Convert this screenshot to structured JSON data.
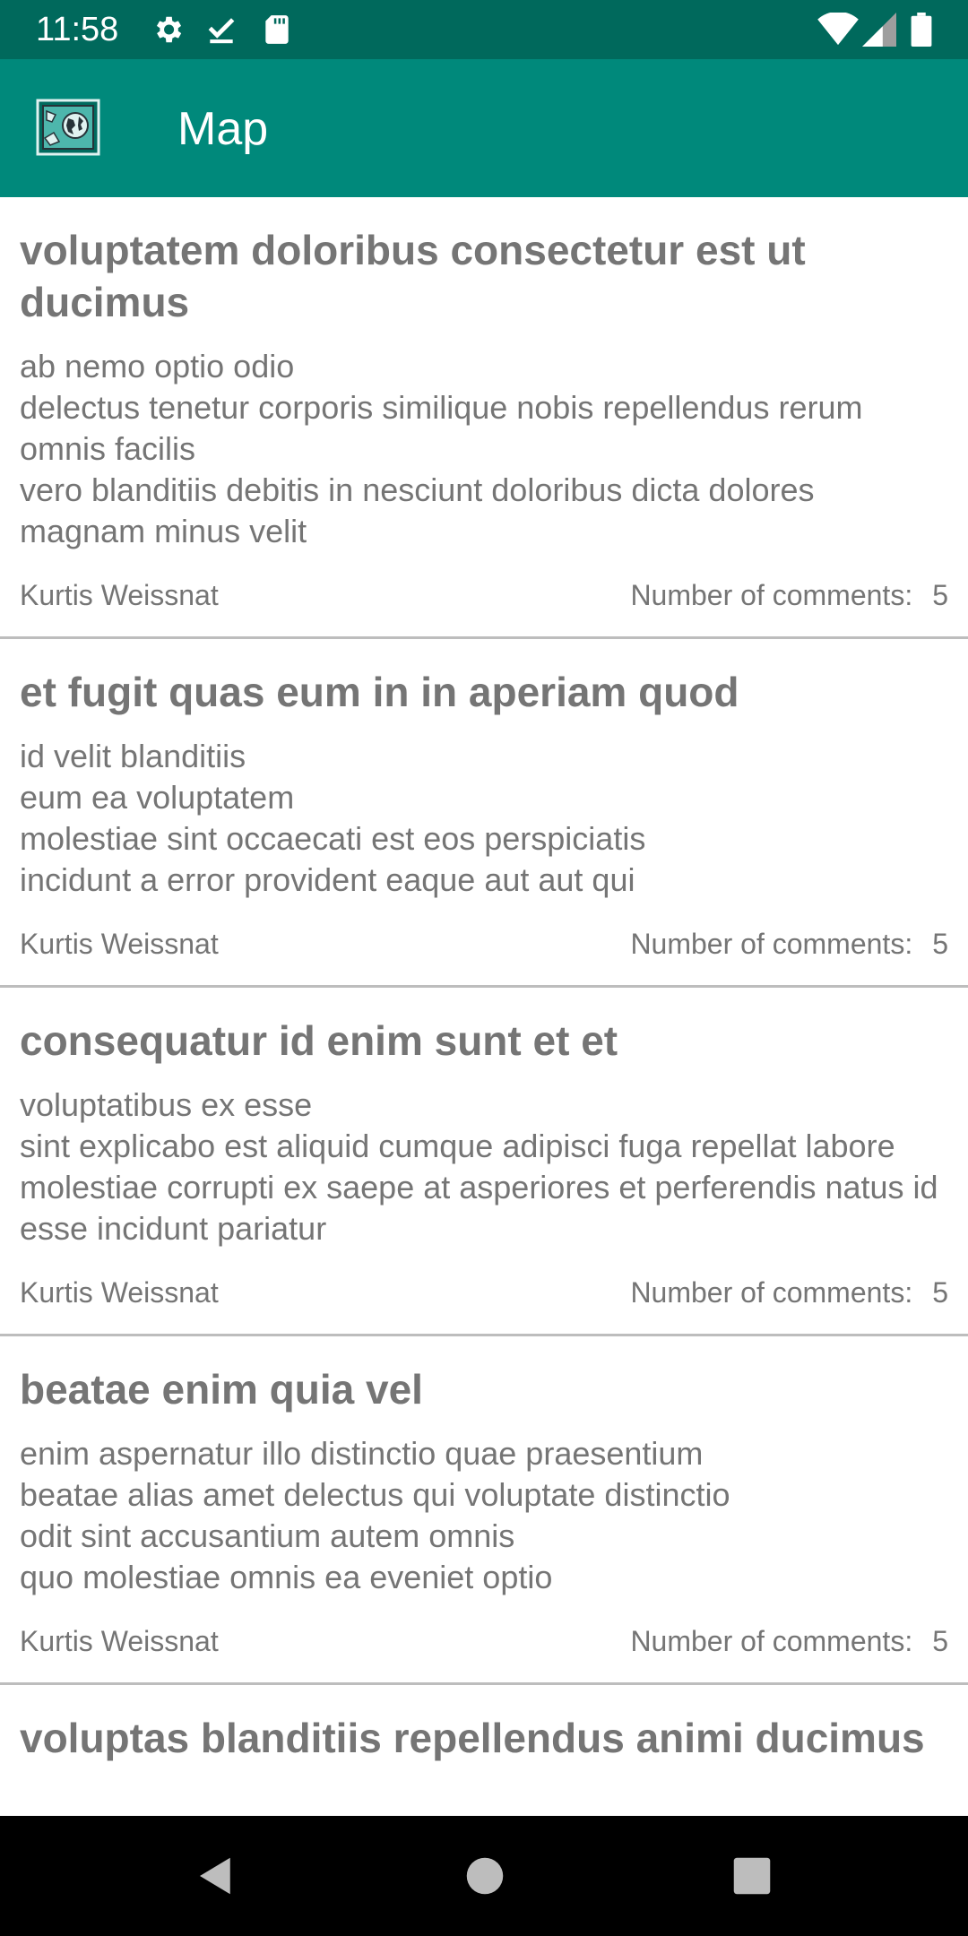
{
  "status_bar": {
    "time": "11:58",
    "left_icons": [
      "settings-icon",
      "download-done-icon",
      "sd-card-icon"
    ],
    "right_icons": [
      "wifi-icon",
      "cell-signal-icon",
      "battery-icon"
    ]
  },
  "app_bar": {
    "title": "Map",
    "logo_icon": "world-map-icon",
    "background": "#00897b",
    "status_background": "#00695c"
  },
  "posts": [
    {
      "title": "voluptatem doloribus consectetur est ut ducimus",
      "body": "ab nemo optio odio\ndelectus tenetur corporis similique nobis repellendus rerum omnis facilis\nvero blanditiis debitis in nesciunt doloribus dicta dolores magnam minus velit",
      "author": "Kurtis Weissnat",
      "comments_label": "Number of comments:",
      "comments_count": "5"
    },
    {
      "title": "et fugit quas eum in in aperiam quod",
      "body": "id velit blanditiis\neum ea voluptatem\nmolestiae sint occaecati est eos perspiciatis\nincidunt a error provident eaque aut aut qui",
      "author": "Kurtis Weissnat",
      "comments_label": "Number of comments:",
      "comments_count": "5"
    },
    {
      "title": "consequatur id enim sunt et et",
      "body": "voluptatibus ex esse\nsint explicabo est aliquid cumque adipisci fuga repellat labore\nmolestiae corrupti ex saepe at asperiores et perferendis natus id esse incidunt pariatur",
      "author": "Kurtis Weissnat",
      "comments_label": "Number of comments:",
      "comments_count": "5"
    },
    {
      "title": "beatae enim quia vel",
      "body": "enim aspernatur illo distinctio quae praesentium\nbeatae alias amet delectus qui voluptate distinctio\nodit sint accusantium autem omnis\nquo molestiae omnis ea eveniet optio",
      "author": "Kurtis Weissnat",
      "comments_label": "Number of comments:",
      "comments_count": "5"
    },
    {
      "title": "voluptas blanditiis repellendus animi ducimus"
    }
  ],
  "nav_bar": {
    "buttons": [
      "back-icon",
      "home-icon",
      "recents-icon"
    ]
  }
}
